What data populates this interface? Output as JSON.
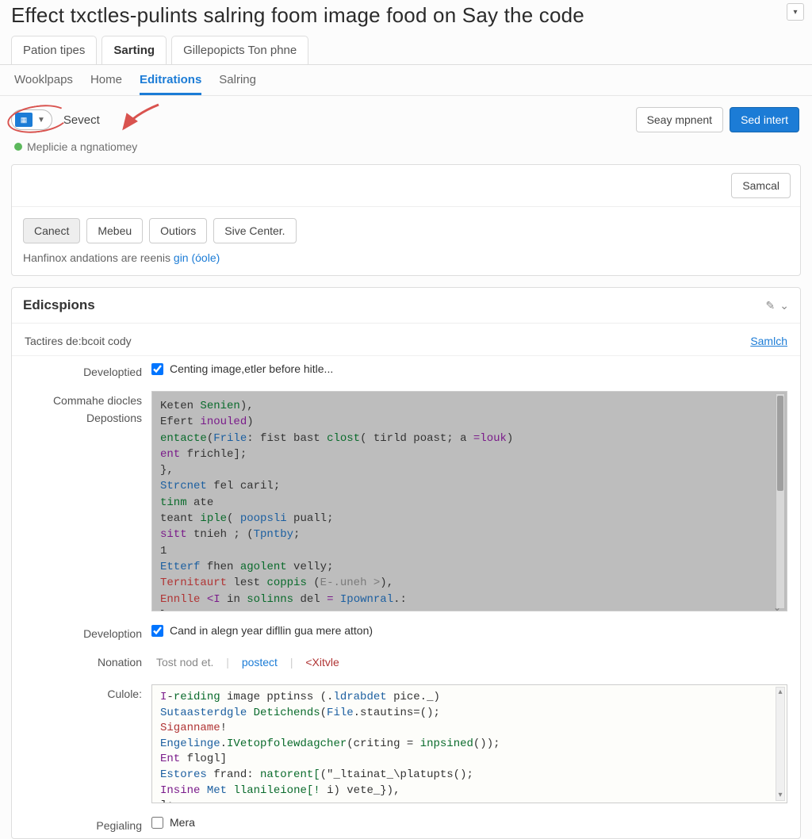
{
  "title": "Effect txctles-pulints salring foom image food on Say the code",
  "tabs": [
    {
      "label": "Pation tipes",
      "active": false
    },
    {
      "label": "Sarting",
      "active": true
    },
    {
      "label": "Gillepopicts Ton phne",
      "active": false
    }
  ],
  "subnav": [
    {
      "label": "Wooklpaps",
      "active": false
    },
    {
      "label": "Home",
      "active": false
    },
    {
      "label": "Editrations",
      "active": true
    },
    {
      "label": "Salring",
      "active": false
    }
  ],
  "select_label": "Sevect",
  "top_buttons": {
    "left": "Seay mpnent",
    "right": "Sed intert"
  },
  "status_text": "Meplicie a ngnatiomey",
  "panel1": {
    "right_btn": "Samcal",
    "btns": [
      "Canect",
      "Mebeu",
      "Outiors",
      "Sive Center."
    ],
    "note_pre": "Hanfinox andations are reenis ",
    "note_link": "gin (óole)"
  },
  "section": {
    "heading": "Edicspions",
    "subrow_left": "Tactires de:bcoit cody",
    "subrow_right": "Samlch",
    "row_dev": {
      "label": "Developtied",
      "text": "Centing image,etler before hitle..."
    },
    "row_code_labels": [
      "Commahe diocles",
      "Depostions"
    ],
    "row_dev2": {
      "label": "Develoption",
      "text": "Cand in alegn year difllin gua mere atton)"
    },
    "row_nonation_label": "Nonation",
    "row_culole_label": "Culole:",
    "mini_tabs": {
      "a": "Tost nod et.",
      "b": "postect",
      "c": "<Xitvle"
    },
    "row_paging": {
      "label": "Pegialing",
      "text": "Mera"
    }
  },
  "code1": [
    [
      "Keten ",
      "fn:Senien",
      "),"
    ],
    [
      "Efert ",
      "kw:inouled",
      ")"
    ],
    [
      "fn:entacte",
      "(",
      "type:Frile",
      ": fist bast ",
      "fn:clost",
      "( tirld poast; a ",
      "kw:=louk",
      ")"
    ],
    [
      "kw:ent",
      " frichle];"
    ],
    [
      "},"
    ],
    [
      "  ",
      "type:Strcnet",
      " fel caril;"
    ],
    [
      "  ",
      "fn:tinm",
      " ate"
    ],
    [
      "  teant ",
      "fn:iple",
      "( ",
      "type:poopsli",
      " puall;"
    ],
    [
      "  ",
      "kw:sitt",
      " tnieh ; (",
      "type:Tpntby",
      ";"
    ],
    [
      "1"
    ],
    [
      "  ",
      "type:Etterf",
      " fhen ",
      "fn:agolent",
      " velly;"
    ],
    [
      "  ",
      "str:Ternitaurt",
      " lest ",
      "fn:coppis",
      " (",
      "com:E-.uneh >",
      "),"
    ],
    [
      "  ",
      "str:Ennlle",
      " ",
      "kw:<I",
      " in ",
      "fn:solinns",
      " del ",
      "kw:=",
      " ",
      "type:Ipownral",
      ".:"
    ],
    [
      "};"
    ]
  ],
  "code2": [
    [
      "kw:I",
      "-",
      "fn:reiding",
      " image pptinss (.",
      "type:ldrabdet",
      " pice._)"
    ],
    [
      "type:Sutaasterdgle",
      " ",
      "fn:Detichends",
      "(",
      "type:File",
      ".stautins=();"
    ],
    [
      "str:Siganname",
      "!"
    ],
    [
      "type:Engelinge",
      ".",
      "fn:IVetopfolewdagcher",
      "(criting = ",
      "fn:inpsined",
      "());"
    ],
    [
      "kw:Ent",
      " flogl]"
    ],
    [
      "type:Estores",
      " frand: ",
      "fn:natorent[",
      "(\"_ltainat_\\platupts();"
    ],
    [
      "kw:Insine",
      " ",
      "type:Met",
      " ",
      "fn:llanileione[!",
      " i) vete_}),"
    ],
    [
      "];"
    ]
  ]
}
